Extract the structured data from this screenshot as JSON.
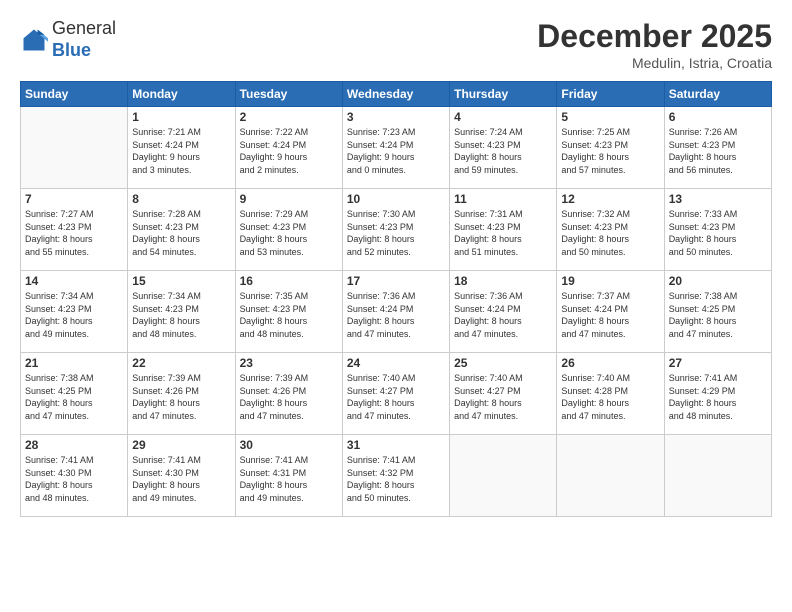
{
  "header": {
    "logo_general": "General",
    "logo_blue": "Blue",
    "month_year": "December 2025",
    "location": "Medulin, Istria, Croatia"
  },
  "weekdays": [
    "Sunday",
    "Monday",
    "Tuesday",
    "Wednesday",
    "Thursday",
    "Friday",
    "Saturday"
  ],
  "weeks": [
    [
      {
        "day": "",
        "info": ""
      },
      {
        "day": "1",
        "info": "Sunrise: 7:21 AM\nSunset: 4:24 PM\nDaylight: 9 hours\nand 3 minutes."
      },
      {
        "day": "2",
        "info": "Sunrise: 7:22 AM\nSunset: 4:24 PM\nDaylight: 9 hours\nand 2 minutes."
      },
      {
        "day": "3",
        "info": "Sunrise: 7:23 AM\nSunset: 4:24 PM\nDaylight: 9 hours\nand 0 minutes."
      },
      {
        "day": "4",
        "info": "Sunrise: 7:24 AM\nSunset: 4:23 PM\nDaylight: 8 hours\nand 59 minutes."
      },
      {
        "day": "5",
        "info": "Sunrise: 7:25 AM\nSunset: 4:23 PM\nDaylight: 8 hours\nand 57 minutes."
      },
      {
        "day": "6",
        "info": "Sunrise: 7:26 AM\nSunset: 4:23 PM\nDaylight: 8 hours\nand 56 minutes."
      }
    ],
    [
      {
        "day": "7",
        "info": "Sunrise: 7:27 AM\nSunset: 4:23 PM\nDaylight: 8 hours\nand 55 minutes."
      },
      {
        "day": "8",
        "info": "Sunrise: 7:28 AM\nSunset: 4:23 PM\nDaylight: 8 hours\nand 54 minutes."
      },
      {
        "day": "9",
        "info": "Sunrise: 7:29 AM\nSunset: 4:23 PM\nDaylight: 8 hours\nand 53 minutes."
      },
      {
        "day": "10",
        "info": "Sunrise: 7:30 AM\nSunset: 4:23 PM\nDaylight: 8 hours\nand 52 minutes."
      },
      {
        "day": "11",
        "info": "Sunrise: 7:31 AM\nSunset: 4:23 PM\nDaylight: 8 hours\nand 51 minutes."
      },
      {
        "day": "12",
        "info": "Sunrise: 7:32 AM\nSunset: 4:23 PM\nDaylight: 8 hours\nand 50 minutes."
      },
      {
        "day": "13",
        "info": "Sunrise: 7:33 AM\nSunset: 4:23 PM\nDaylight: 8 hours\nand 50 minutes."
      }
    ],
    [
      {
        "day": "14",
        "info": "Sunrise: 7:34 AM\nSunset: 4:23 PM\nDaylight: 8 hours\nand 49 minutes."
      },
      {
        "day": "15",
        "info": "Sunrise: 7:34 AM\nSunset: 4:23 PM\nDaylight: 8 hours\nand 48 minutes."
      },
      {
        "day": "16",
        "info": "Sunrise: 7:35 AM\nSunset: 4:23 PM\nDaylight: 8 hours\nand 48 minutes."
      },
      {
        "day": "17",
        "info": "Sunrise: 7:36 AM\nSunset: 4:24 PM\nDaylight: 8 hours\nand 47 minutes."
      },
      {
        "day": "18",
        "info": "Sunrise: 7:36 AM\nSunset: 4:24 PM\nDaylight: 8 hours\nand 47 minutes."
      },
      {
        "day": "19",
        "info": "Sunrise: 7:37 AM\nSunset: 4:24 PM\nDaylight: 8 hours\nand 47 minutes."
      },
      {
        "day": "20",
        "info": "Sunrise: 7:38 AM\nSunset: 4:25 PM\nDaylight: 8 hours\nand 47 minutes."
      }
    ],
    [
      {
        "day": "21",
        "info": "Sunrise: 7:38 AM\nSunset: 4:25 PM\nDaylight: 8 hours\nand 47 minutes."
      },
      {
        "day": "22",
        "info": "Sunrise: 7:39 AM\nSunset: 4:26 PM\nDaylight: 8 hours\nand 47 minutes."
      },
      {
        "day": "23",
        "info": "Sunrise: 7:39 AM\nSunset: 4:26 PM\nDaylight: 8 hours\nand 47 minutes."
      },
      {
        "day": "24",
        "info": "Sunrise: 7:40 AM\nSunset: 4:27 PM\nDaylight: 8 hours\nand 47 minutes."
      },
      {
        "day": "25",
        "info": "Sunrise: 7:40 AM\nSunset: 4:27 PM\nDaylight: 8 hours\nand 47 minutes."
      },
      {
        "day": "26",
        "info": "Sunrise: 7:40 AM\nSunset: 4:28 PM\nDaylight: 8 hours\nand 47 minutes."
      },
      {
        "day": "27",
        "info": "Sunrise: 7:41 AM\nSunset: 4:29 PM\nDaylight: 8 hours\nand 48 minutes."
      }
    ],
    [
      {
        "day": "28",
        "info": "Sunrise: 7:41 AM\nSunset: 4:30 PM\nDaylight: 8 hours\nand 48 minutes."
      },
      {
        "day": "29",
        "info": "Sunrise: 7:41 AM\nSunset: 4:30 PM\nDaylight: 8 hours\nand 49 minutes."
      },
      {
        "day": "30",
        "info": "Sunrise: 7:41 AM\nSunset: 4:31 PM\nDaylight: 8 hours\nand 49 minutes."
      },
      {
        "day": "31",
        "info": "Sunrise: 7:41 AM\nSunset: 4:32 PM\nDaylight: 8 hours\nand 50 minutes."
      },
      {
        "day": "",
        "info": ""
      },
      {
        "day": "",
        "info": ""
      },
      {
        "day": "",
        "info": ""
      }
    ]
  ]
}
